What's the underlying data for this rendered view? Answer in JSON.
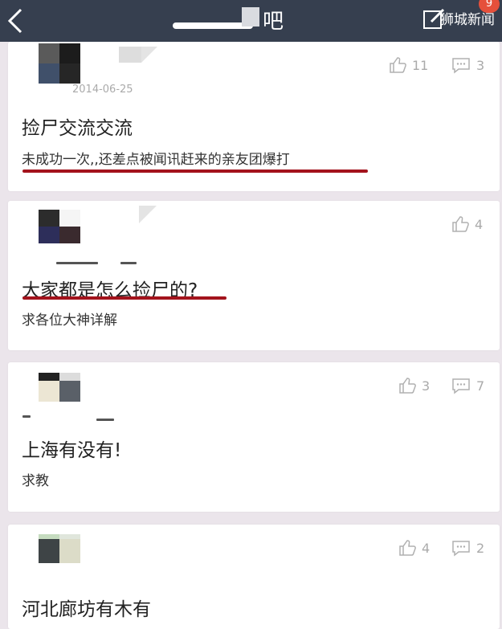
{
  "header": {
    "forum_name_suffix": "吧",
    "badge_count": "9",
    "watermark": "狮城新闻"
  },
  "posts": [
    {
      "date": "2014-06-25",
      "title": "捡尸交流交流",
      "body": "未成功一次,,还差点被闻讯赶来的亲友团爆打",
      "likes": "11",
      "comments": "3"
    },
    {
      "title": "大家都是怎么捡尸的?",
      "body": "求各位大神详解",
      "likes": "4"
    },
    {
      "title": "上海有没有!",
      "body": "求教",
      "likes": "3",
      "comments": "7"
    },
    {
      "title": "河北廊坊有木有",
      "likes": "4",
      "comments": "2"
    }
  ],
  "colors": {
    "header_bg": "#363f4f",
    "underline": "#a3131c",
    "badge": "#e5503b"
  }
}
